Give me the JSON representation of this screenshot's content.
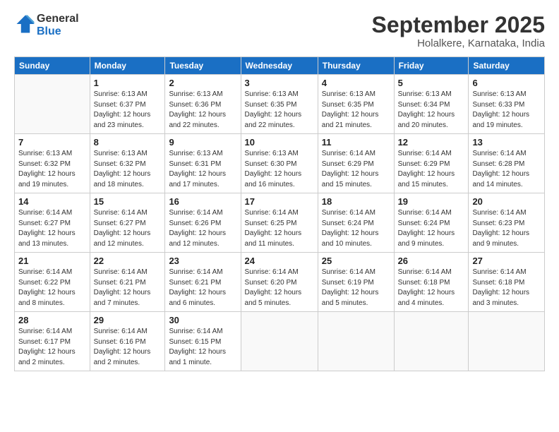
{
  "logo": {
    "line1": "General",
    "line2": "Blue"
  },
  "title": "September 2025",
  "subtitle": "Holalkere, Karnataka, India",
  "weekdays": [
    "Sunday",
    "Monday",
    "Tuesday",
    "Wednesday",
    "Thursday",
    "Friday",
    "Saturday"
  ],
  "weeks": [
    [
      {
        "day": "",
        "info": ""
      },
      {
        "day": "1",
        "info": "Sunrise: 6:13 AM\nSunset: 6:37 PM\nDaylight: 12 hours\nand 23 minutes."
      },
      {
        "day": "2",
        "info": "Sunrise: 6:13 AM\nSunset: 6:36 PM\nDaylight: 12 hours\nand 22 minutes."
      },
      {
        "day": "3",
        "info": "Sunrise: 6:13 AM\nSunset: 6:35 PM\nDaylight: 12 hours\nand 22 minutes."
      },
      {
        "day": "4",
        "info": "Sunrise: 6:13 AM\nSunset: 6:35 PM\nDaylight: 12 hours\nand 21 minutes."
      },
      {
        "day": "5",
        "info": "Sunrise: 6:13 AM\nSunset: 6:34 PM\nDaylight: 12 hours\nand 20 minutes."
      },
      {
        "day": "6",
        "info": "Sunrise: 6:13 AM\nSunset: 6:33 PM\nDaylight: 12 hours\nand 19 minutes."
      }
    ],
    [
      {
        "day": "7",
        "info": "Sunrise: 6:13 AM\nSunset: 6:32 PM\nDaylight: 12 hours\nand 19 minutes."
      },
      {
        "day": "8",
        "info": "Sunrise: 6:13 AM\nSunset: 6:32 PM\nDaylight: 12 hours\nand 18 minutes."
      },
      {
        "day": "9",
        "info": "Sunrise: 6:13 AM\nSunset: 6:31 PM\nDaylight: 12 hours\nand 17 minutes."
      },
      {
        "day": "10",
        "info": "Sunrise: 6:13 AM\nSunset: 6:30 PM\nDaylight: 12 hours\nand 16 minutes."
      },
      {
        "day": "11",
        "info": "Sunrise: 6:14 AM\nSunset: 6:29 PM\nDaylight: 12 hours\nand 15 minutes."
      },
      {
        "day": "12",
        "info": "Sunrise: 6:14 AM\nSunset: 6:29 PM\nDaylight: 12 hours\nand 15 minutes."
      },
      {
        "day": "13",
        "info": "Sunrise: 6:14 AM\nSunset: 6:28 PM\nDaylight: 12 hours\nand 14 minutes."
      }
    ],
    [
      {
        "day": "14",
        "info": "Sunrise: 6:14 AM\nSunset: 6:27 PM\nDaylight: 12 hours\nand 13 minutes."
      },
      {
        "day": "15",
        "info": "Sunrise: 6:14 AM\nSunset: 6:27 PM\nDaylight: 12 hours\nand 12 minutes."
      },
      {
        "day": "16",
        "info": "Sunrise: 6:14 AM\nSunset: 6:26 PM\nDaylight: 12 hours\nand 12 minutes."
      },
      {
        "day": "17",
        "info": "Sunrise: 6:14 AM\nSunset: 6:25 PM\nDaylight: 12 hours\nand 11 minutes."
      },
      {
        "day": "18",
        "info": "Sunrise: 6:14 AM\nSunset: 6:24 PM\nDaylight: 12 hours\nand 10 minutes."
      },
      {
        "day": "19",
        "info": "Sunrise: 6:14 AM\nSunset: 6:24 PM\nDaylight: 12 hours\nand 9 minutes."
      },
      {
        "day": "20",
        "info": "Sunrise: 6:14 AM\nSunset: 6:23 PM\nDaylight: 12 hours\nand 9 minutes."
      }
    ],
    [
      {
        "day": "21",
        "info": "Sunrise: 6:14 AM\nSunset: 6:22 PM\nDaylight: 12 hours\nand 8 minutes."
      },
      {
        "day": "22",
        "info": "Sunrise: 6:14 AM\nSunset: 6:21 PM\nDaylight: 12 hours\nand 7 minutes."
      },
      {
        "day": "23",
        "info": "Sunrise: 6:14 AM\nSunset: 6:21 PM\nDaylight: 12 hours\nand 6 minutes."
      },
      {
        "day": "24",
        "info": "Sunrise: 6:14 AM\nSunset: 6:20 PM\nDaylight: 12 hours\nand 5 minutes."
      },
      {
        "day": "25",
        "info": "Sunrise: 6:14 AM\nSunset: 6:19 PM\nDaylight: 12 hours\nand 5 minutes."
      },
      {
        "day": "26",
        "info": "Sunrise: 6:14 AM\nSunset: 6:18 PM\nDaylight: 12 hours\nand 4 minutes."
      },
      {
        "day": "27",
        "info": "Sunrise: 6:14 AM\nSunset: 6:18 PM\nDaylight: 12 hours\nand 3 minutes."
      }
    ],
    [
      {
        "day": "28",
        "info": "Sunrise: 6:14 AM\nSunset: 6:17 PM\nDaylight: 12 hours\nand 2 minutes."
      },
      {
        "day": "29",
        "info": "Sunrise: 6:14 AM\nSunset: 6:16 PM\nDaylight: 12 hours\nand 2 minutes."
      },
      {
        "day": "30",
        "info": "Sunrise: 6:14 AM\nSunset: 6:15 PM\nDaylight: 12 hours\nand 1 minute."
      },
      {
        "day": "",
        "info": ""
      },
      {
        "day": "",
        "info": ""
      },
      {
        "day": "",
        "info": ""
      },
      {
        "day": "",
        "info": ""
      }
    ]
  ]
}
